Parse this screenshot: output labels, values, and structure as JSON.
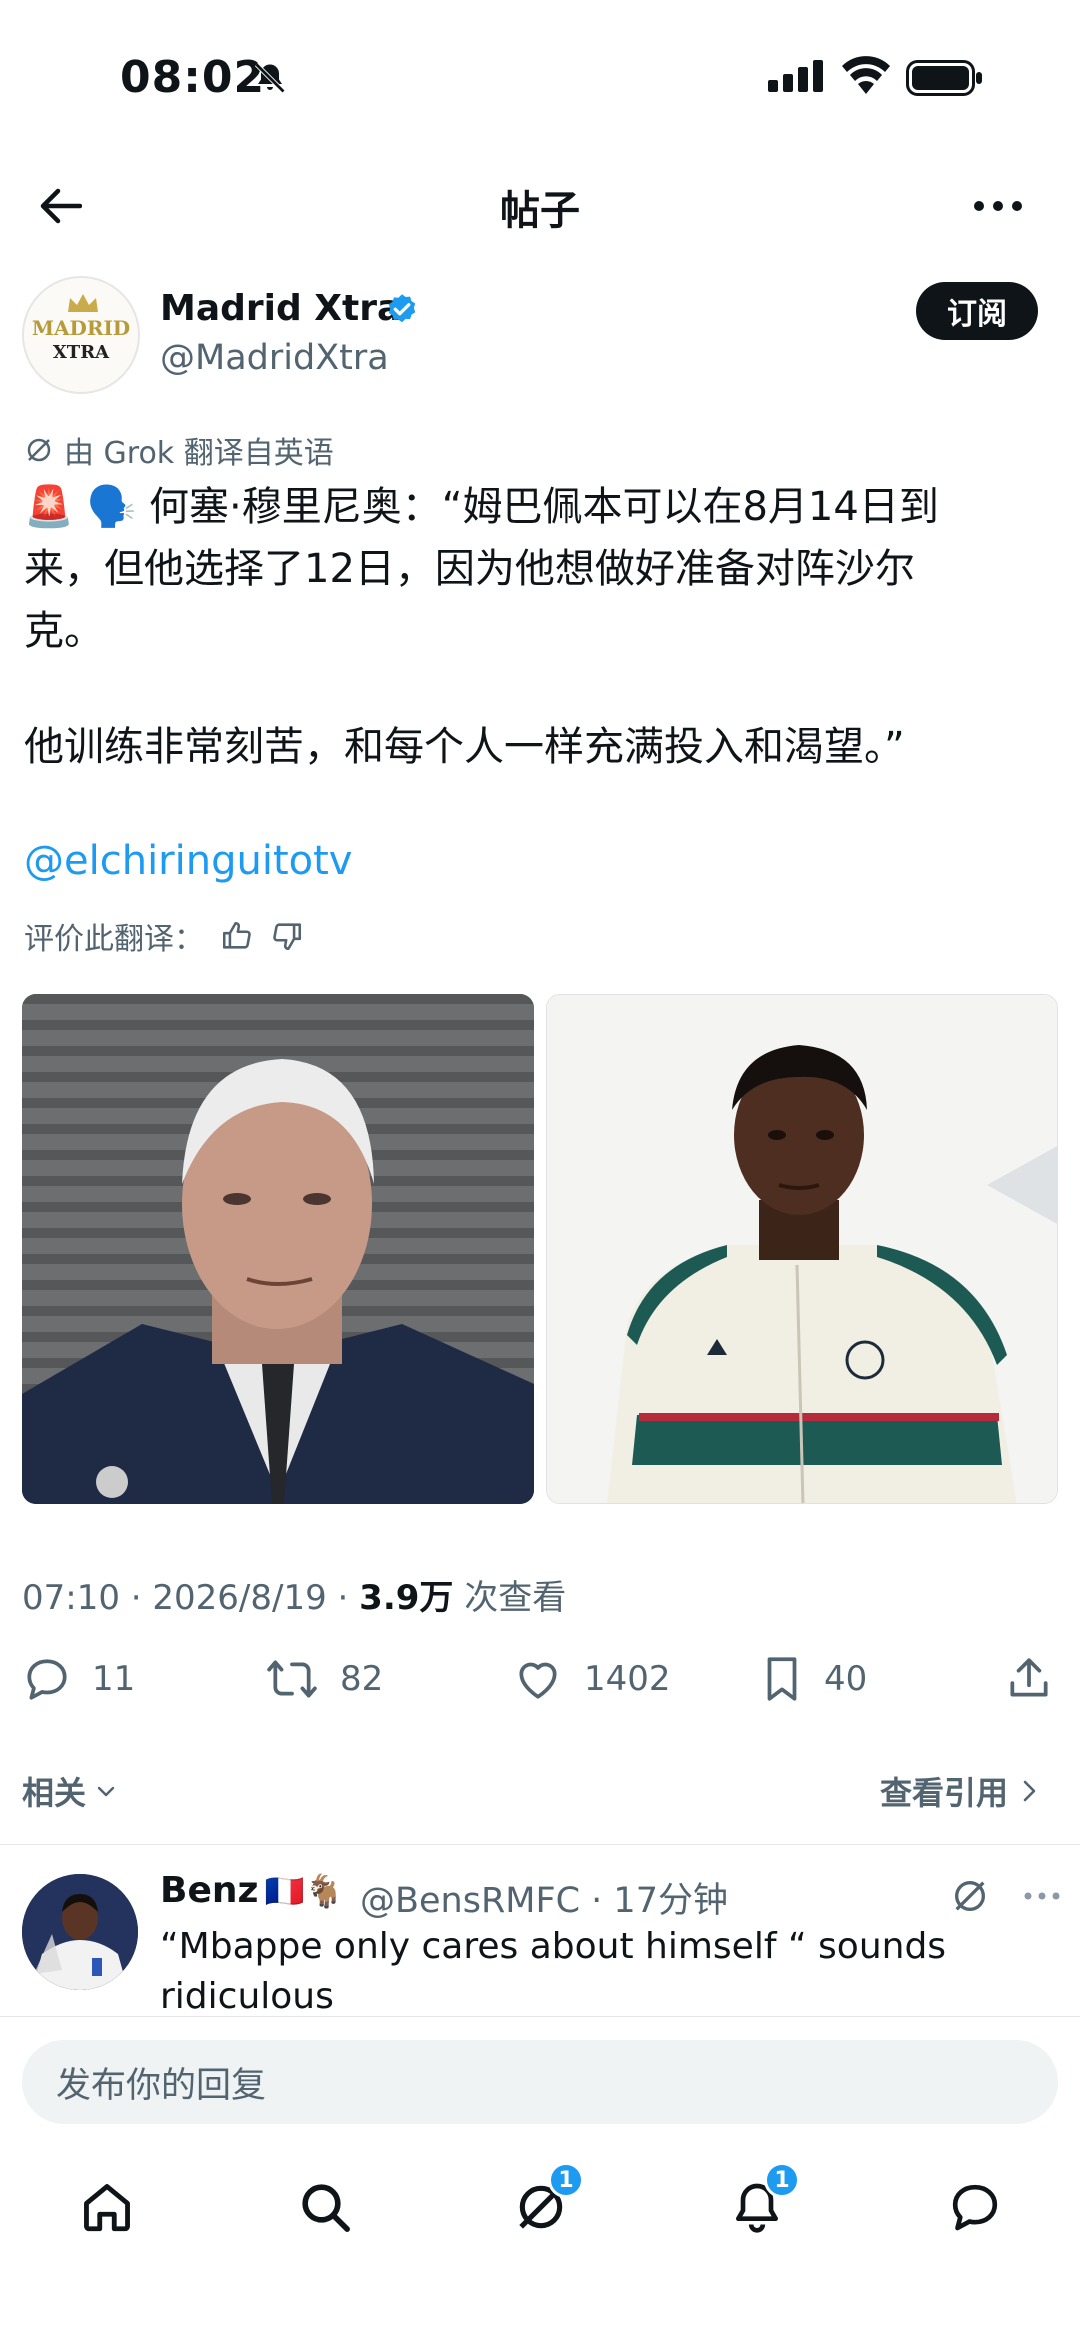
{
  "status_bar": {
    "time": "08:02"
  },
  "header": {
    "title": "帖子"
  },
  "author": {
    "name": "Madrid Xtra",
    "handle": "@MadridXtra",
    "subscribe_label": "订阅",
    "avatar_text_top": "MADRID",
    "avatar_text_bottom": "XTRA"
  },
  "tweet": {
    "translated_note": "由 Grok 翻译自英语",
    "emoji_lead": "🚨 🗣️",
    "lines": [
      "何塞·穆里尼奥：“姆巴佩本可以在8月14日到",
      "来，但他选择了12日，因为他想做好准备对阵沙尔",
      "克。",
      "他训练非常刻苦，和每个人一样充满投入和渴望。”"
    ],
    "mention": "@elchiringuitotv",
    "rate_label": "评价此翻译："
  },
  "meta": {
    "time_date": "07:10 · 2026/8/19 · ",
    "views_count": "3.9万",
    "views_label": " 次查看"
  },
  "actions": {
    "replies": "11",
    "reposts": "82",
    "likes": "1402",
    "bookmarks": "40"
  },
  "related": {
    "label": "相关",
    "view_quotes": "查看引用"
  },
  "reply": {
    "name": "Benz",
    "name_emoji": "🇫🇷🐐",
    "handle_time": "@BensRMFC · 17分钟",
    "lines": [
      "“Mbappe only cares about himself “ sounds",
      "ridiculous"
    ]
  },
  "compose": {
    "placeholder": "发布你的回复"
  },
  "tabbar": {
    "messages_badge": "1",
    "notifications_badge": "1"
  },
  "colors": {
    "accent": "#1d9bf0",
    "text": "#0f1419",
    "secondary": "#536471"
  }
}
